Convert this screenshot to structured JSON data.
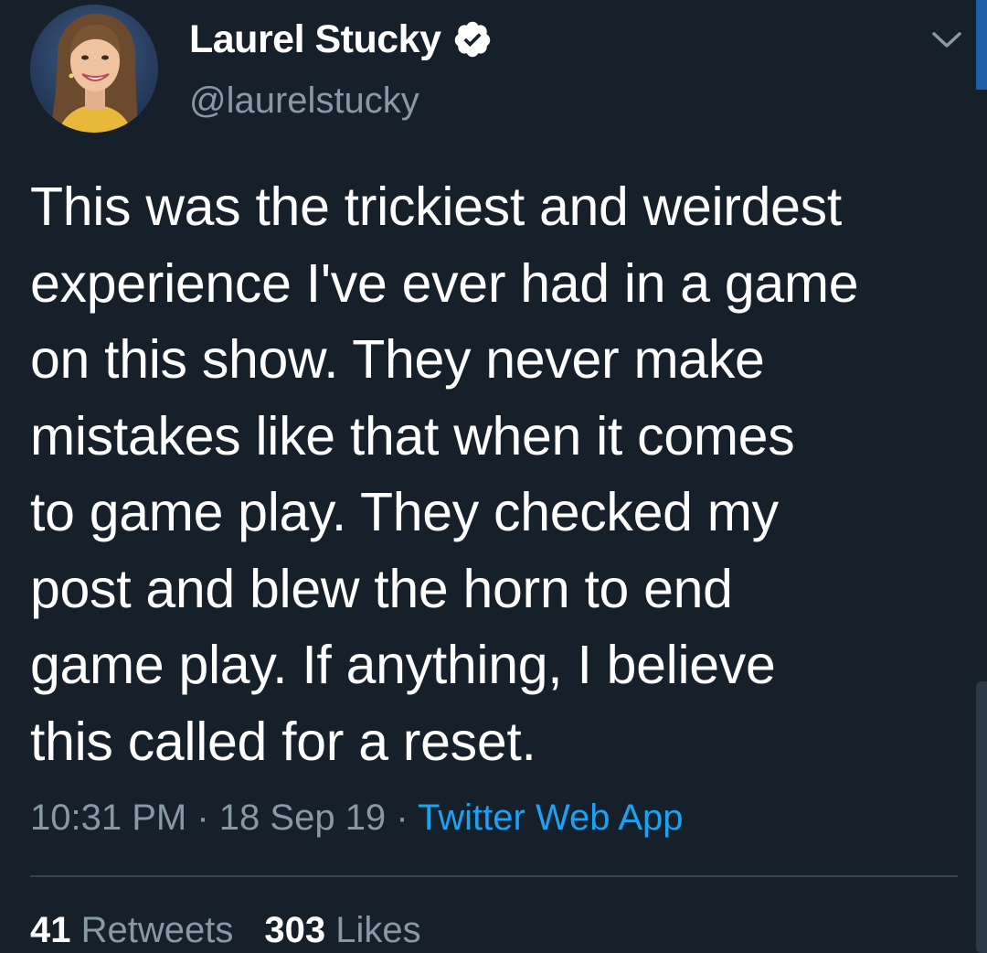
{
  "author": {
    "display_name": "Laurel Stucky",
    "handle": "@laurelstucky",
    "verified": true
  },
  "tweet": {
    "text": "This was the trickiest and weirdest\nexperience I've ever had in a game\non this show. They never make\nmistakes like that when it comes\nto game play. They checked my\npost and blew the horn to end\ngame play. If anything, I believe\nthis called for a reset.",
    "time": "10:31 PM",
    "separator": "·",
    "date": "18 Sep 19",
    "source": "Twitter Web App"
  },
  "stats": {
    "retweets_count": "41",
    "retweets_label": "Retweets",
    "likes_count": "303",
    "likes_label": "Likes"
  },
  "icons": {
    "verified": "verified-badge-icon",
    "menu": "chevron-down-icon"
  },
  "colors": {
    "background": "#15202b",
    "text": "#ffffff",
    "muted": "#8899a6",
    "link": "#1da1f2",
    "divider": "#38444d"
  }
}
